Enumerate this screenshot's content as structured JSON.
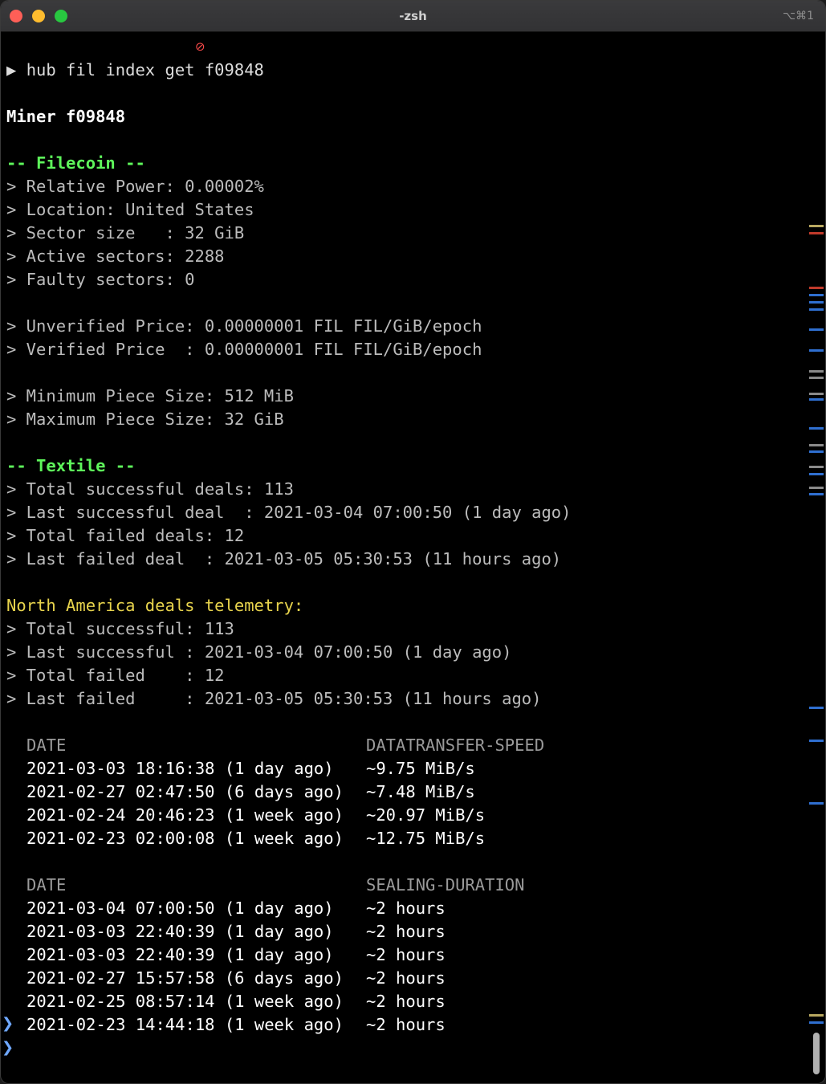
{
  "window": {
    "title": "-zsh",
    "shortcut": "⌥⌘1"
  },
  "terminal": {
    "prompt_symbol": "▶",
    "command": "hub fil index get f09848",
    "miner_title": "Miner f09848",
    "filecoin_header": "-- Filecoin --",
    "filecoin": [
      "> Relative Power: 0.00002%",
      "> Location: United States",
      "> Sector size   : 32 GiB",
      "> Active sectors: 2288",
      "> Faulty sectors: 0"
    ],
    "prices": [
      "> Unverified Price: 0.00000001 FIL FIL/GiB/epoch",
      "> Verified Price  : 0.00000001 FIL FIL/GiB/epoch"
    ],
    "piece_sizes": [
      "> Minimum Piece Size: 512 MiB",
      "> Maximum Piece Size: 32 GiB"
    ],
    "textile_header": "-- Textile --",
    "textile": [
      "> Total successful deals: 113",
      "> Last successful deal  : 2021-03-04 07:00:50 (1 day ago)",
      "> Total failed deals: 12",
      "> Last failed deal  : 2021-03-05 05:30:53 (11 hours ago)"
    ],
    "na_header": "North America deals telemetry:",
    "na": [
      "> Total successful: 113",
      "> Last successful : 2021-03-04 07:00:50 (1 day ago)",
      "> Total failed    : 12",
      "> Last failed     : 2021-03-05 05:30:53 (11 hours ago)"
    ],
    "transfer_table": {
      "col_date": "DATE",
      "col_value": "DATATRANSFER-SPEED",
      "rows": [
        {
          "date": "2021-03-03 18:16:38 (1 day ago)",
          "value": "~9.75 MiB/s"
        },
        {
          "date": "2021-02-27 02:47:50 (6 days ago)",
          "value": "~7.48 MiB/s"
        },
        {
          "date": "2021-02-24 20:46:23 (1 week ago)",
          "value": "~20.97 MiB/s"
        },
        {
          "date": "2021-02-23 02:00:08 (1 week ago)",
          "value": "~12.75 MiB/s"
        }
      ]
    },
    "sealing_table": {
      "col_date": "DATE",
      "col_value": "SEALING-DURATION",
      "rows": [
        {
          "date": "2021-03-04 07:00:50 (1 day ago)",
          "value": "~2 hours"
        },
        {
          "date": "2021-03-03 22:40:39 (1 day ago)",
          "value": "~2 hours"
        },
        {
          "date": "2021-03-03 22:40:39 (1 day ago)",
          "value": "~2 hours"
        },
        {
          "date": "2021-02-27 15:57:58 (6 days ago)",
          "value": "~2 hours"
        },
        {
          "date": "2021-02-25 08:57:14 (1 week ago)",
          "value": "~2 hours"
        },
        {
          "date": "2021-02-23 14:44:18 (1 week ago)",
          "value": "~2 hours"
        }
      ]
    }
  },
  "colors": {
    "background": "#000000",
    "heading_green": "#5ef65b",
    "heading_yellow": "#e8d44d",
    "text_gray": "#bcbcbc",
    "prompt_marker_blue": "#6fa8ff"
  }
}
